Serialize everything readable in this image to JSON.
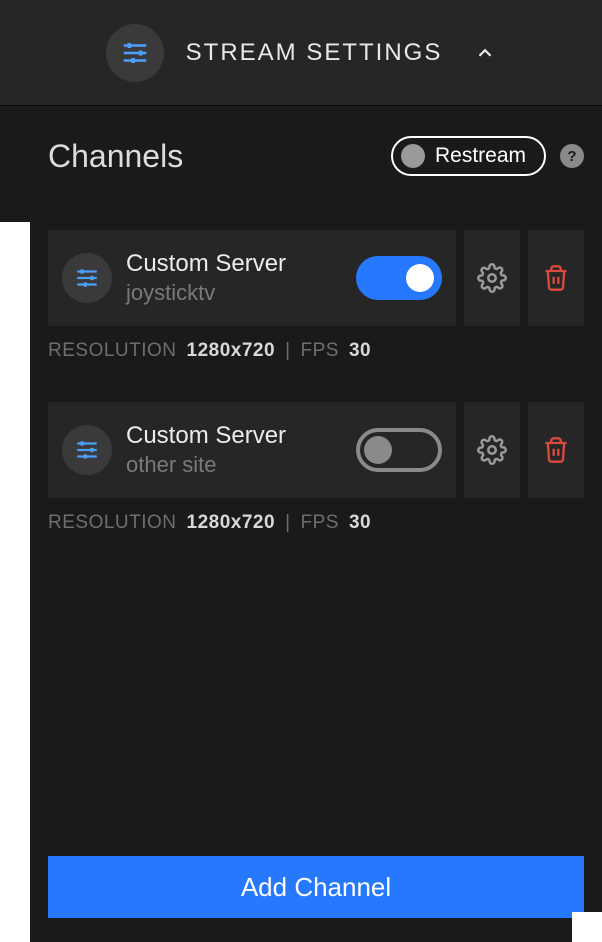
{
  "header": {
    "title": "STREAM SETTINGS"
  },
  "panel": {
    "title": "Channels",
    "restream_label": "Restream",
    "help_symbol": "?"
  },
  "channels": [
    {
      "title": "Custom Server",
      "subtitle": "joysticktv",
      "enabled": true,
      "resolution_label": "RESOLUTION",
      "resolution": "1280x720",
      "fps_label": "FPS",
      "fps": "30"
    },
    {
      "title": "Custom Server",
      "subtitle": "other site",
      "enabled": false,
      "resolution_label": "RESOLUTION",
      "resolution": "1280x720",
      "fps_label": "FPS",
      "fps": "30"
    }
  ],
  "add_button_label": "Add Channel",
  "colors": {
    "accent": "#2678ff",
    "danger": "#d94a3f",
    "slider_blue": "#4aa0ff"
  }
}
